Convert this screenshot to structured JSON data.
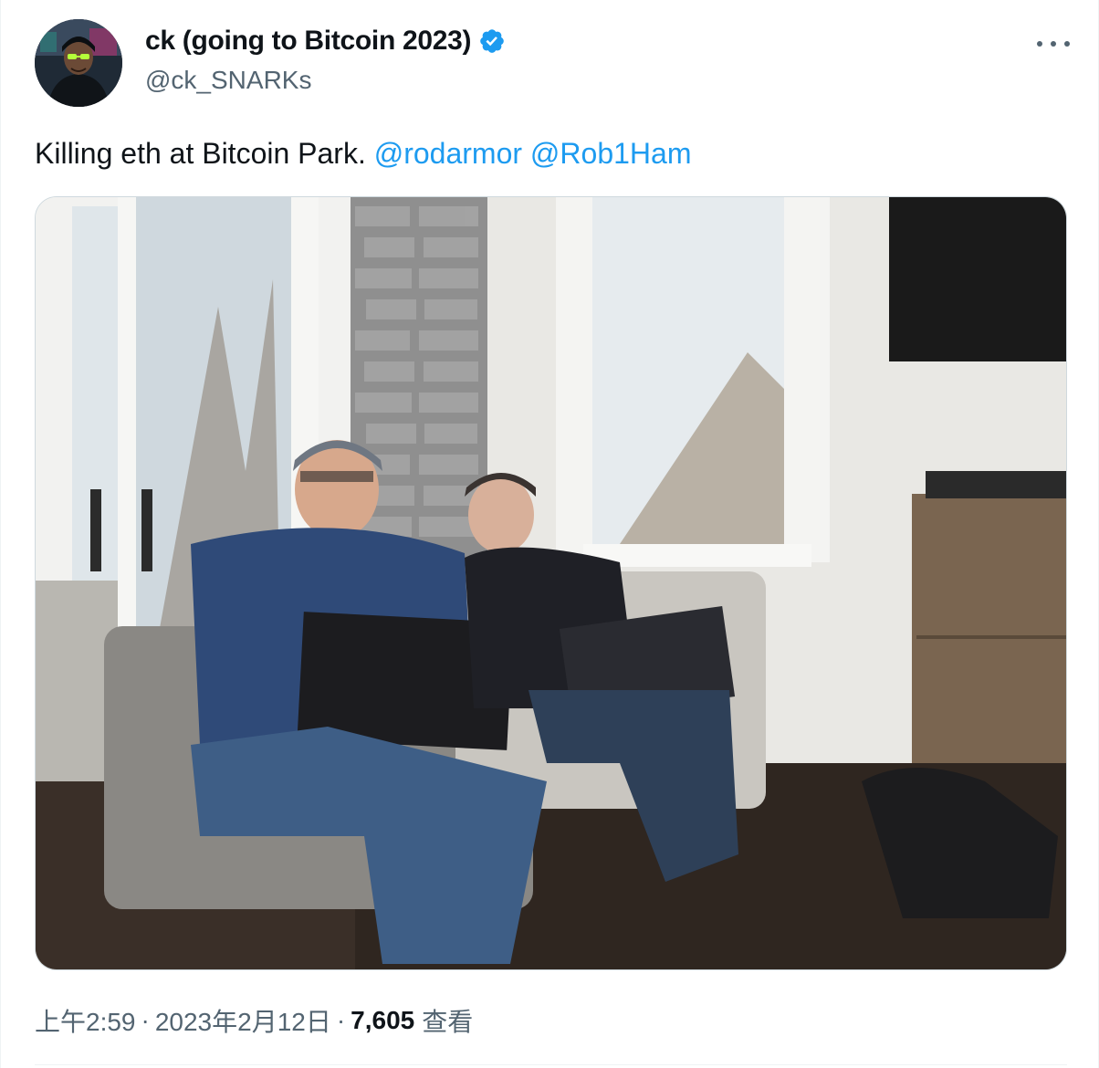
{
  "tweet": {
    "author": {
      "display_name": "ck (going to Bitcoin 2023)",
      "handle": "@ck_SNARKs",
      "verified": true,
      "avatar_icon": "avatar"
    },
    "text_main": "Killing eth at Bitcoin Park. ",
    "mentions": [
      "@rodarmor",
      "@Rob1Ham"
    ],
    "time": "上午2:59",
    "date": "2023年2月12日",
    "separator": "·",
    "views_count": "7,605",
    "views_label": "查看"
  },
  "colors": {
    "accent": "#1d9bf0",
    "text_primary": "#0f1419",
    "text_secondary": "#536471",
    "border": "#cfd9de"
  }
}
